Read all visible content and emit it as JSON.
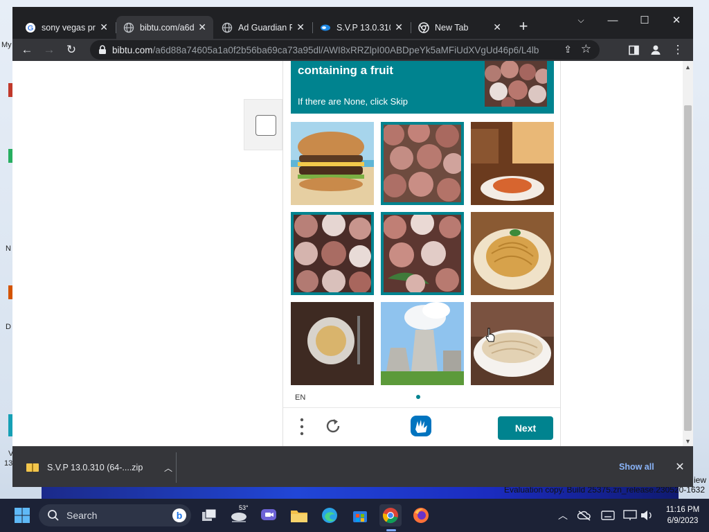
{
  "desktop": {
    "side_labels": [
      "My",
      "N",
      "D",
      "V",
      "13"
    ],
    "watermark_top": "iew",
    "watermark": "Evaluation copy. Build 25375.zn_release.230520-1632"
  },
  "browser": {
    "tabs": [
      {
        "title": "sony vegas pr",
        "favicon": "google-icon",
        "active": false
      },
      {
        "title": "bibtu.com/a6d",
        "favicon": "globe-icon",
        "active": true
      },
      {
        "title": "Ad Guardian F",
        "favicon": "globe-icon",
        "active": false
      },
      {
        "title": "S.V.P 13.0.310",
        "favicon": "svp-icon",
        "active": false
      },
      {
        "title": "New Tab",
        "favicon": "chrome-icon",
        "active": false
      }
    ],
    "url_host": "bibtu.com",
    "url_path": "/a6d88a74605a1a0f2b56ba69ca73a95dl/AWI8xRRZlpI00ABDpeYk5aMFiUdXVgUd46p6/L4lb"
  },
  "captcha": {
    "title": "containing a fruit",
    "subtitle": "If there are None, click Skip",
    "tiles": [
      {
        "subject": "burger",
        "selected": false
      },
      {
        "subject": "lychee",
        "selected": true
      },
      {
        "subject": "restaurant-pasta",
        "selected": false
      },
      {
        "subject": "lychee",
        "selected": true
      },
      {
        "subject": "lychee",
        "selected": true
      },
      {
        "subject": "pasta",
        "selected": false
      },
      {
        "subject": "pasta-bowl-dark",
        "selected": false
      },
      {
        "subject": "power-plant",
        "selected": false
      },
      {
        "subject": "pasta-bowl",
        "selected": false
      }
    ],
    "language": "EN",
    "next_label": "Next"
  },
  "downloads": {
    "file_name": "S.V.P 13.0.310 (64-....zip",
    "show_all_label": "Show all"
  },
  "taskbar": {
    "search_placeholder": "Search",
    "weather_temp": "53°",
    "time": "11:16 PM",
    "date": "6/9/2023"
  },
  "colors": {
    "captcha_teal": "#00838f",
    "chrome_dark": "#202124",
    "chrome_toolbar": "#35363a",
    "link_blue": "#8ab4f8"
  }
}
